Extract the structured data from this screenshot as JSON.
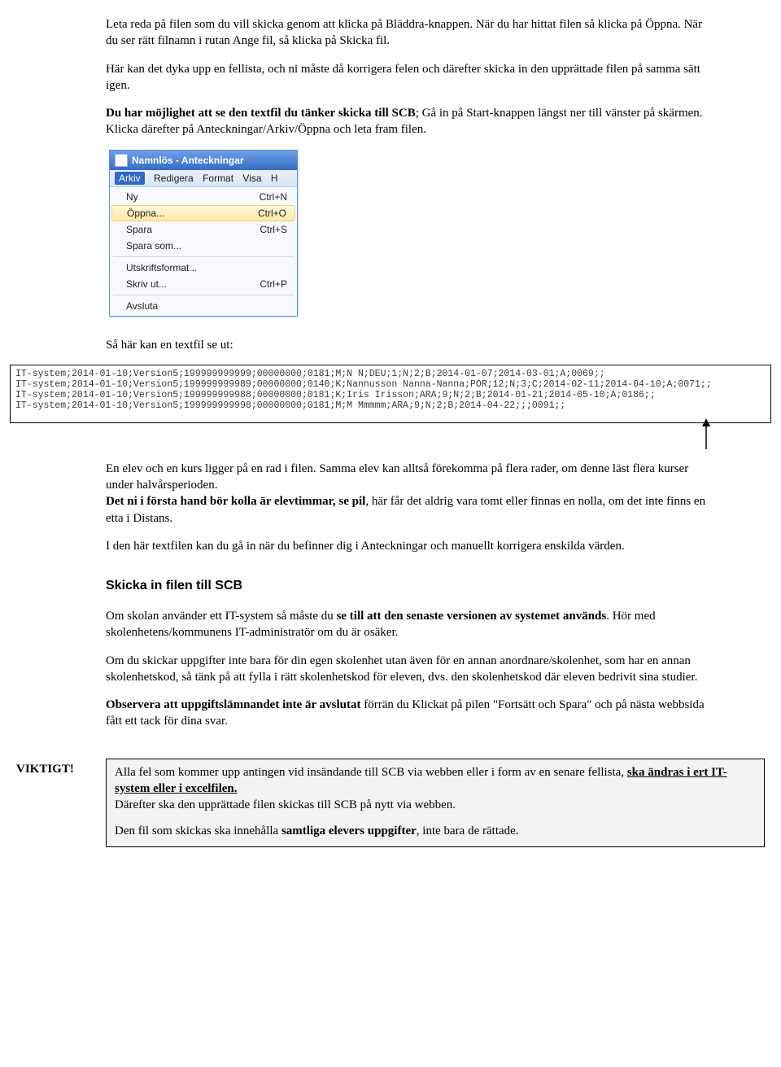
{
  "intro": {
    "p1": "Leta reda på filen som du vill skicka genom att klicka på Bläddra-knappen. När du har hittat filen så klicka på Öppna. När du ser rätt filnamn i rutan Ange fil, så klicka på Skicka fil.",
    "p2": "Här kan det dyka upp en fellista, och ni måste då korrigera felen och därefter skicka in den upprättade filen på samma sätt igen.",
    "p3_lead": "Du har möjlighet att se den textfil du tänker skicka till SCB",
    "p3_rest": "; Gå in på Start-knappen längst ner till vänster på skärmen. Klicka därefter på Anteckningar/Arkiv/Öppna och leta fram filen."
  },
  "notepad": {
    "title": "Namnlös - Anteckningar",
    "menubar": {
      "arkiv": "Arkiv",
      "redigera": "Redigera",
      "format": "Format",
      "visa": "Visa",
      "h": "H"
    },
    "items": [
      {
        "label": "Ny",
        "shortcut": "Ctrl+N"
      },
      {
        "label": "Öppna...",
        "shortcut": "Ctrl+O",
        "hl": true
      },
      {
        "label": "Spara",
        "shortcut": "Ctrl+S"
      },
      {
        "label": "Spara som...",
        "shortcut": ""
      }
    ],
    "items2": [
      {
        "label": "Utskriftsformat...",
        "shortcut": ""
      },
      {
        "label": "Skriv ut...",
        "shortcut": "Ctrl+P"
      }
    ],
    "items3": [
      {
        "label": "Avsluta",
        "shortcut": ""
      }
    ]
  },
  "textfile": {
    "caption": "Så här kan en textfil se ut:",
    "line1": "IT-system;2014-01-10;Version5;199999999999;00000000;0181;M;N N;DEU;1;N;2;B;2014-01-07;2014-03-01;A;0069;;",
    "line2": "IT-system;2014-01-10;Version5;199999999989;00000000;0140;K;Nannusson Nanna-Nanna;POR;12;N;3;C;2014-02-11;2014-04-10;A;0071;;",
    "line3": "IT-system;2014-01-10;Version5;199999999988;00000000;0181;K;Iris Irisson;ARA;9;N;2;B;2014-01-21;2014-05-10;A;0186;;",
    "line4": "IT-system;2014-01-10;Version5;199999999998;00000000;0181;M;M Mmmmm;ARA;9;N;2;B;2014-04-22;;;0091;;"
  },
  "body2": {
    "p1a": "En elev och en kurs ligger på en rad i filen. Samma elev kan alltså förekomma på flera rader, om denne läst flera kurser under halvårsperioden.",
    "p1b_lead": "Det ni i första hand bör kolla är elevtimmar, se pil",
    "p1b_rest": ", här får det aldrig vara tomt eller finnas en nolla, om det inte finns en etta i Distans.",
    "p2": "I den här textfilen kan du gå in när du befinner dig i Anteckningar och manuellt korrigera enskilda värden."
  },
  "section_heading": "Skicka in filen till SCB",
  "body3": {
    "p1a": "Om skolan använder ett IT-system så måste du ",
    "p1b": "se till att den senaste versionen av systemet används",
    "p1c": ". Hör med skolenhetens/kommunens IT-administratör om du är osäker.",
    "p2": "Om du skickar uppgifter inte bara för din egen skolenhet utan även för en annan anordnare/skolenhet, som har en annan skolenhetskod, så tänk på att fylla i rätt skolenhetskod för eleven, dvs. den skolenhetskod där eleven bedrivit sina studier.",
    "p3a": "Observera att uppgiftslämnandet inte är avslutat",
    "p3b": " förrän du Klickat på  pilen \"Fortsätt och Spara\" och på nästa webbsida fått ett tack för dina svar."
  },
  "callout": {
    "label": "VIKTIGT!",
    "p1a": "Alla fel som kommer upp antingen vid insändande till SCB via webben eller i form av en senare fellista, ",
    "p1b": "ska ändras i ert IT-system eller i excelfilen.",
    "p1c": "Därefter ska den upprättade filen skickas till SCB på nytt via webben.",
    "p2a": "Den fil som skickas ska innehålla ",
    "p2b": "samtliga elevers uppgifter",
    "p2c": ", inte bara de rättade."
  }
}
